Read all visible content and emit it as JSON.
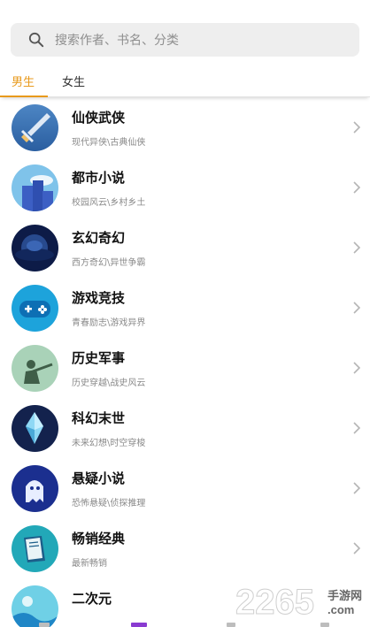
{
  "search": {
    "placeholder": "搜索作者、书名、分类",
    "icon": "search-icon"
  },
  "tabs": [
    {
      "label": "男生",
      "active": true
    },
    {
      "label": "女生",
      "active": false
    }
  ],
  "accent_color": "#e89a1c",
  "categories": [
    {
      "title": "仙侠武侠",
      "subtitle": "现代异侠\\古典仙侠",
      "icon": "sword-icon"
    },
    {
      "title": "都市小说",
      "subtitle": "校园风云\\乡村乡土",
      "icon": "city-icon"
    },
    {
      "title": "玄幻奇幻",
      "subtitle": "西方奇幻\\异世争霸",
      "icon": "planet-icon"
    },
    {
      "title": "游戏竞技",
      "subtitle": "青春励志\\游戏异界",
      "icon": "gamepad-icon"
    },
    {
      "title": "历史军事",
      "subtitle": "历史穿越\\战史风云",
      "icon": "soldier-icon"
    },
    {
      "title": "科幻末世",
      "subtitle": "未来幻想\\时空穿梭",
      "icon": "crystal-icon"
    },
    {
      "title": "悬疑小说",
      "subtitle": "恐怖悬疑\\侦探推理",
      "icon": "ghost-icon"
    },
    {
      "title": "畅销经典",
      "subtitle": "最新畅销",
      "icon": "book-icon"
    },
    {
      "title": "二次元",
      "subtitle": "",
      "icon": "wave-icon"
    }
  ],
  "watermark": {
    "number": "2265",
    "site": "手游网",
    "domain": ".com"
  }
}
